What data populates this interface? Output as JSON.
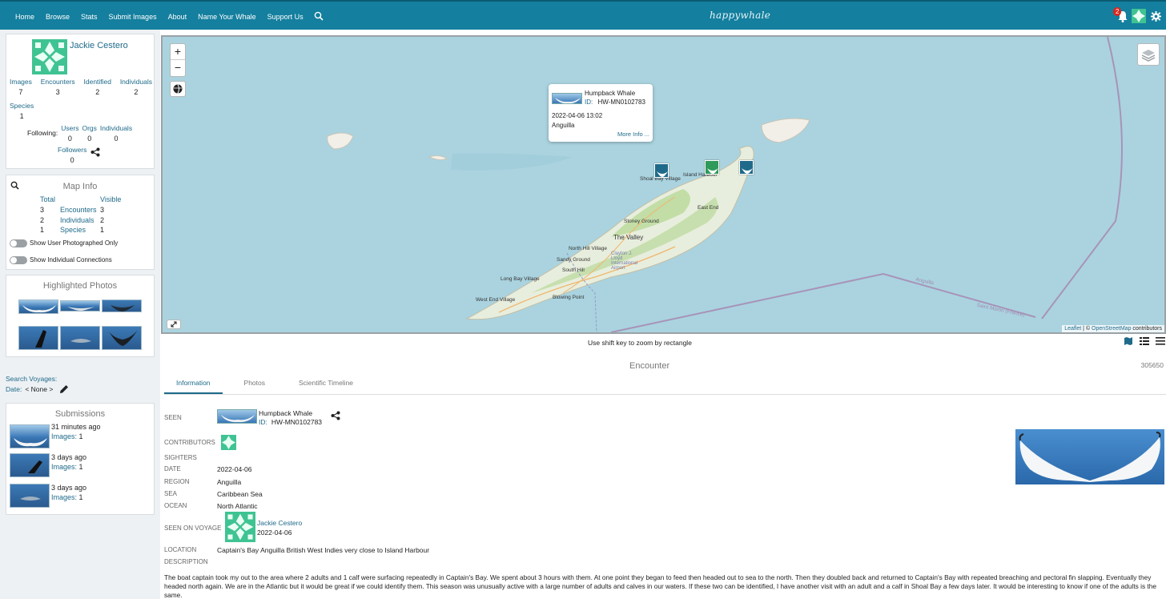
{
  "nav": {
    "items": [
      "Home",
      "Browse",
      "Stats",
      "Submit Images",
      "About",
      "Name Your Whale",
      "Support Us"
    ],
    "brand": "happywhale",
    "notification_count": "2"
  },
  "profile": {
    "name": "Jackie Cestero",
    "stats": [
      {
        "label": "Images",
        "value": "7"
      },
      {
        "label": "Encounters",
        "value": "3"
      },
      {
        "label": "Identified",
        "value": "2"
      },
      {
        "label": "Individuals",
        "value": "2"
      }
    ],
    "species_label": "Species",
    "species_value": "1",
    "following_label": "Following:",
    "following": [
      {
        "label": "Users",
        "value": "0"
      },
      {
        "label": "Orgs",
        "value": "0"
      },
      {
        "label": "Individuals",
        "value": "0"
      }
    ],
    "followers_label": "Followers",
    "followers_value": "0"
  },
  "map_info": {
    "title": "Map Info",
    "col_total": "Total",
    "col_visible": "Visible",
    "rows": [
      {
        "total": "3",
        "label": "Encounters",
        "visible": "3"
      },
      {
        "total": "2",
        "label": "Individuals",
        "visible": "2"
      },
      {
        "total": "1",
        "label": "Species",
        "visible": "1"
      }
    ],
    "toggle_user_photographed": "Show User Photographed Only",
    "toggle_individual_connections": "Show Individual Connections"
  },
  "highlighted_photos": {
    "title": "Highlighted Photos"
  },
  "voyages": {
    "search_label": "Search Voyages:",
    "date_label": "Date:",
    "date_value": "< None >"
  },
  "submissions": {
    "title": "Submissions",
    "items": [
      {
        "time": "31 minutes ago",
        "images_label": "Images:",
        "images_value": "1"
      },
      {
        "time": "3 days ago",
        "images_label": "Images:",
        "images_value": "1"
      },
      {
        "time": "3 days ago",
        "images_label": "Images:",
        "images_value": "1"
      }
    ]
  },
  "map": {
    "zoom_in": "+",
    "zoom_out": "−",
    "popup": {
      "species": "Humpback Whale",
      "id_label": "ID:",
      "id_value": "HW-MN0102783",
      "datetime": "2022-04-06 13:02",
      "region": "Anguilla",
      "more_info": "More Info ..."
    },
    "places": [
      "Shoal Bay Village",
      "Island Harbour",
      "East End",
      "Stoney Ground",
      "The Valley",
      "North Hill Village",
      "Sandy Ground",
      "South Hill",
      "Long Bay Village",
      "West End Village",
      "Blowing Point",
      "Clayton J. Lloyd International Airport",
      "Anguilla",
      "Saint Martin (France)"
    ],
    "attribution_leaflet": "Leaflet",
    "attribution_rest": " | © ",
    "attribution_osm": "OpenStreetMap",
    "attribution_tail": " contributors",
    "shift_hint": "Use shift key to zoom by rectangle"
  },
  "encounter": {
    "title": "Encounter",
    "id": "305650",
    "tabs": [
      "Information",
      "Photos",
      "Scientific Timeline"
    ],
    "seen_label": "SEEN",
    "seen_species": "Humpback Whale",
    "seen_id_label": "ID:",
    "seen_id_value": "HW-MN0102783",
    "contributors_label": "CONTRIBUTORS",
    "sighters_label": "SIGHTERS",
    "date_label": "DATE",
    "date_value": "2022-04-06",
    "region_label": "REGION",
    "region_value": "Anguilla",
    "sea_label": "SEA",
    "sea_value": "Caribbean Sea",
    "ocean_label": "OCEAN",
    "ocean_value": "North Atlantic",
    "voyage_label": "SEEN ON VOYAGE",
    "voyage_name": "Jackie Cestero",
    "voyage_date": "2022-04-06",
    "location_label": "LOCATION",
    "location_value": "Captain's Bay Anguilla British West Indies very close to Island Harbour",
    "description_label": "DESCRIPTION",
    "description": "The boat captain took my out to the area where 2 adults and 1 calf were surfacing repeatedly in Captain's Bay. We spent about 3 hours with them. At one point they began to feed then headed out to sea to the north. Then they doubled back and returned to Captain's Bay with repeated breaching and pectoral fin slapping. Eventually they headed north again. We are in the Atlantic but it would be great if we could identify them. This season was unusually active with a large number of adults and calves in our waters. If these two can be identified, I have another visit with an adult and a calf in Shoal Bay a few days later. It would be interesting to know if one of the adults is the same."
  }
}
